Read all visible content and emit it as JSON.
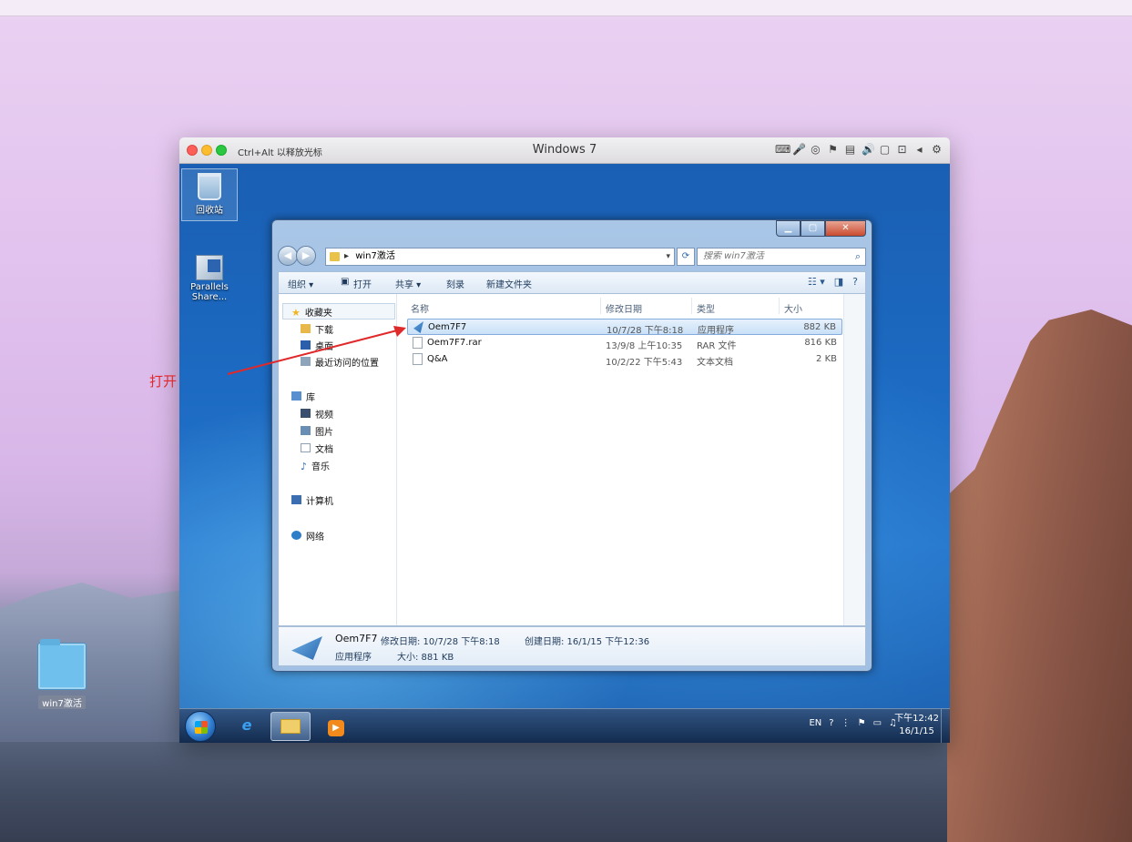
{
  "vm": {
    "hint": "Ctrl+Alt 以释放光标",
    "title": "Windows 7",
    "tools": [
      "⌨",
      "🎤",
      "◎",
      "⚑",
      "▤",
      "🔊",
      "▢",
      "⊡",
      "◂",
      "⚙"
    ]
  },
  "desktop_icons": {
    "recycle_bin": "回收站",
    "parallels_share": "Parallels Share..."
  },
  "explorer": {
    "address": "win7激活",
    "search_placeholder": "搜索 win7激活",
    "commands": {
      "organize": "组织 ▾",
      "open": "打开",
      "share": "共享 ▾",
      "burn": "刻录",
      "new_folder": "新建文件夹"
    },
    "nav": {
      "favorites": "收藏夹",
      "downloads": "下载",
      "desktop": "桌面",
      "recent": "最近访问的位置",
      "libraries": "库",
      "videos": "视频",
      "pictures": "图片",
      "documents": "文档",
      "music": "音乐",
      "computer": "计算机",
      "network": "网络"
    },
    "columns": {
      "name": "名称",
      "modified": "修改日期",
      "type": "类型",
      "size": "大小"
    },
    "files": [
      {
        "name": "Oem7F7",
        "modified": "10/7/28 下午8:18",
        "type": "应用程序",
        "size": "882 KB"
      },
      {
        "name": "Oem7F7.rar",
        "modified": "13/9/8 上午10:35",
        "type": "RAR 文件",
        "size": "816 KB"
      },
      {
        "name": "Q&A",
        "modified": "10/2/22 下午5:43",
        "type": "文本文档",
        "size": "2 KB"
      }
    ],
    "details": {
      "name": "Oem7F7",
      "modified_label": "修改日期: 10/7/28 下午8:18",
      "created_label": "创建日期: 16/1/15 下午12:36",
      "type": "应用程序",
      "size_label": "大小: 881 KB"
    }
  },
  "taskbar": {
    "tray_lang": "EN",
    "clock_time": "下午12:42",
    "clock_date": "16/1/15"
  },
  "annotation": {
    "text": "打开",
    "color": "#e0292b"
  },
  "mac_desktop": {
    "folder_label": "win7激活"
  }
}
